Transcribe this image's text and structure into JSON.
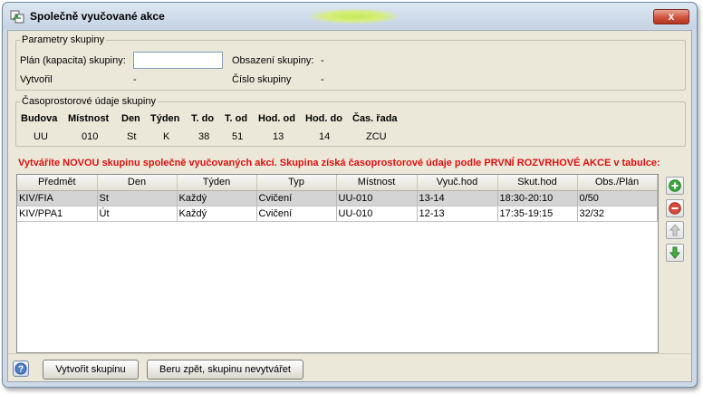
{
  "window": {
    "title": "Společně vyučované akce",
    "close_label": "x"
  },
  "params": {
    "legend": "Parametry skupiny",
    "plan_label": "Plán (kapacita) skupiny:",
    "plan_value": "",
    "occupancy_label": "Obsazení skupiny:",
    "occupancy_value": "-",
    "created_label": "Vytvořil",
    "created_value": "-",
    "group_number_label": "Číslo skupiny",
    "group_number_value": "-"
  },
  "schedule": {
    "legend": "Časoprostorové údaje skupiny",
    "headers": [
      "Budova",
      "Místnost",
      "Den",
      "Týden",
      "T. do",
      "T. od",
      "Hod. od",
      "Hod. do",
      "Čas. řada"
    ],
    "values": [
      "UU",
      "010",
      "St",
      "K",
      "38",
      "51",
      "13",
      "14",
      "ZCU"
    ]
  },
  "notice": "Vytváříte NOVOU skupinu společně vyučovaných akcí. Skupina získá časoprostorové údaje podle PRVNÍ ROZVRHOVÉ AKCE v tabulce:",
  "table": {
    "columns": [
      "Předmět",
      "Den",
      "Týden",
      "Typ",
      "Místnost",
      "Vyuč.hod",
      "Skut.hod",
      "Obs./Plán"
    ],
    "rows": [
      [
        "KIV/FIA",
        "St",
        "Každý",
        "Cvičení",
        "UU-010",
        "13-14",
        "18:30-20:10",
        "0/50"
      ],
      [
        "KIV/PPA1",
        "Út",
        "Každý",
        "Cvičení",
        "UU-010",
        "12-13",
        "17:35-19:15",
        "32/32"
      ]
    ]
  },
  "footer": {
    "create_label": "Vytvořit skupinu",
    "cancel_label": "Beru zpět, skupinu nevytvářet"
  },
  "icons": {
    "add": "plus-icon",
    "remove": "minus-icon",
    "up": "arrow-up-icon",
    "down": "arrow-down-icon",
    "help": "help-icon"
  },
  "colors": {
    "notice": "#e01010",
    "selected_row": "#d4d4d4",
    "add": "#3da83d",
    "remove": "#d64a3a"
  }
}
